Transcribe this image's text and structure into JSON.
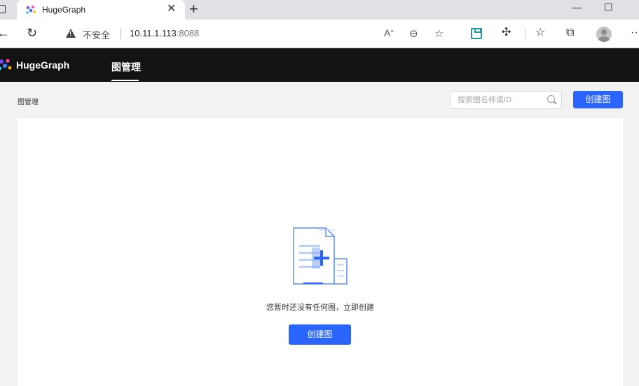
{
  "browser": {
    "tab_title": "HugeGraph",
    "tab_close": "✕",
    "new_tab": "+",
    "window_minimize": "—",
    "window_maximize": "☐",
    "window_close": "✕",
    "security_label": "不安全",
    "url_host": "10.11.1.113",
    "url_port": ":8088",
    "icons": [
      "back-icon",
      "refresh-icon",
      "warning-icon",
      "read-aloud-icon",
      "zoom-icon",
      "add-favorite-icon",
      "save-icon",
      "extensions-icon",
      "favorites-icon",
      "collections-icon",
      "profile-icon",
      "more-icon"
    ],
    "accent": "#1a9aa6"
  },
  "app": {
    "logo_text": "HugeGraph",
    "nav_items": [
      {
        "label": "图管理",
        "active": true
      }
    ],
    "header_bg": "#131313"
  },
  "page": {
    "breadcrumb": "图管理",
    "search_placeholder": "搜索图名称或ID",
    "create_button_label": "创建图",
    "empty_text": "您暂时还没有任何图，立即创建",
    "empty_create_button_label": "创建图",
    "primary_color": "#2b65ff"
  }
}
